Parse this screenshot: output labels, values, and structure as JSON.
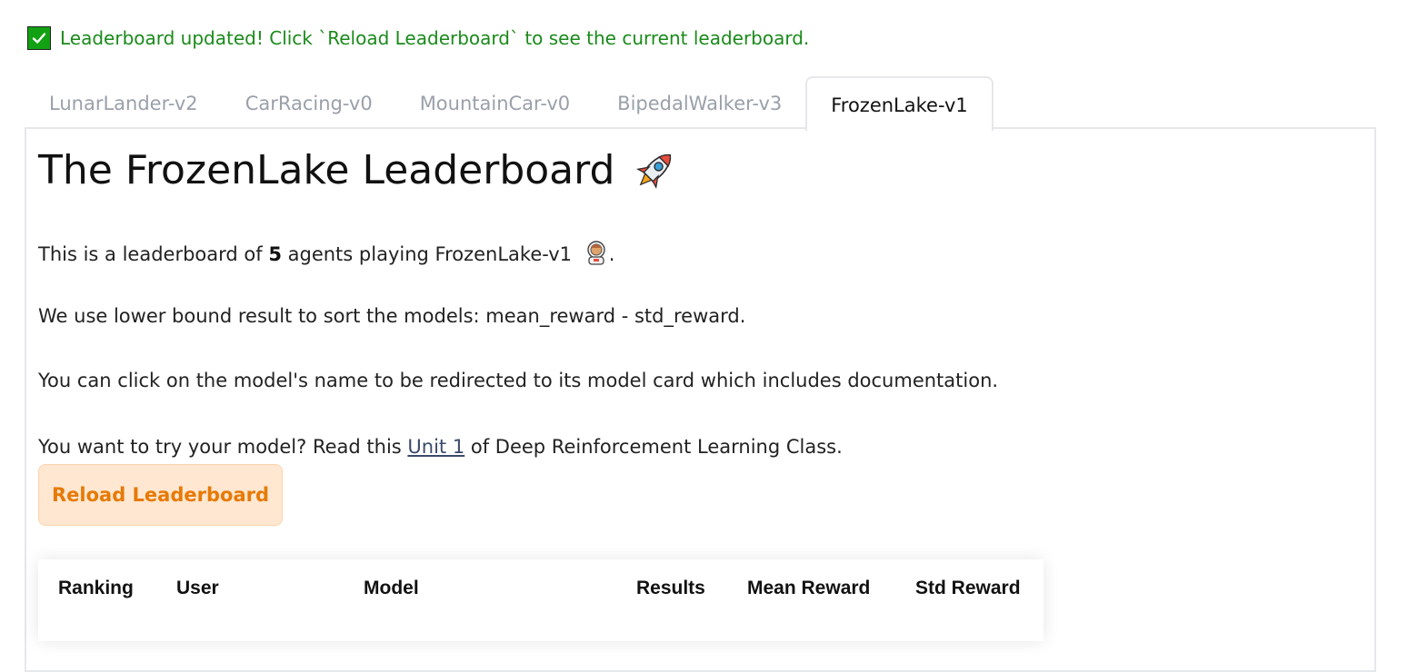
{
  "status": {
    "message": "Leaderboard updated! Click `Reload Leaderboard` to see the current leaderboard.",
    "icon": "check-mark-icon",
    "color": "#1a8a1a"
  },
  "tabs": [
    {
      "label": "LunarLander-v2",
      "active": false
    },
    {
      "label": "CarRacing-v0",
      "active": false
    },
    {
      "label": "MountainCar-v0",
      "active": false
    },
    {
      "label": "BipedalWalker-v3",
      "active": false
    },
    {
      "label": "FrozenLake-v1",
      "active": true
    }
  ],
  "main": {
    "title": "The FrozenLake Leaderboard",
    "title_icon": "rocket-icon",
    "intro_prefix": "This is a leaderboard of ",
    "agent_count": "5",
    "intro_suffix": " agents playing FrozenLake-v1",
    "intro_icon": "astronaut-icon",
    "intro_end": ".",
    "sort_text": "We use lower bound result to sort the models: mean_reward - std_reward.",
    "click_text": "You can click on the model's name to be redirected to its model card which includes documentation.",
    "try_prefix": "You want to try your model? Read this ",
    "try_link": "Unit 1",
    "try_suffix": " of Deep Reinforcement Learning Class.",
    "reload_button": "Reload Leaderboard"
  },
  "table": {
    "headers": [
      "Ranking",
      "User",
      "Model",
      "Results",
      "Mean Reward",
      "Std Reward"
    ]
  },
  "colors": {
    "accent": "#e67a06",
    "button_bg": "#ffe7d1",
    "inactive_tab": "#9aa0aa"
  }
}
